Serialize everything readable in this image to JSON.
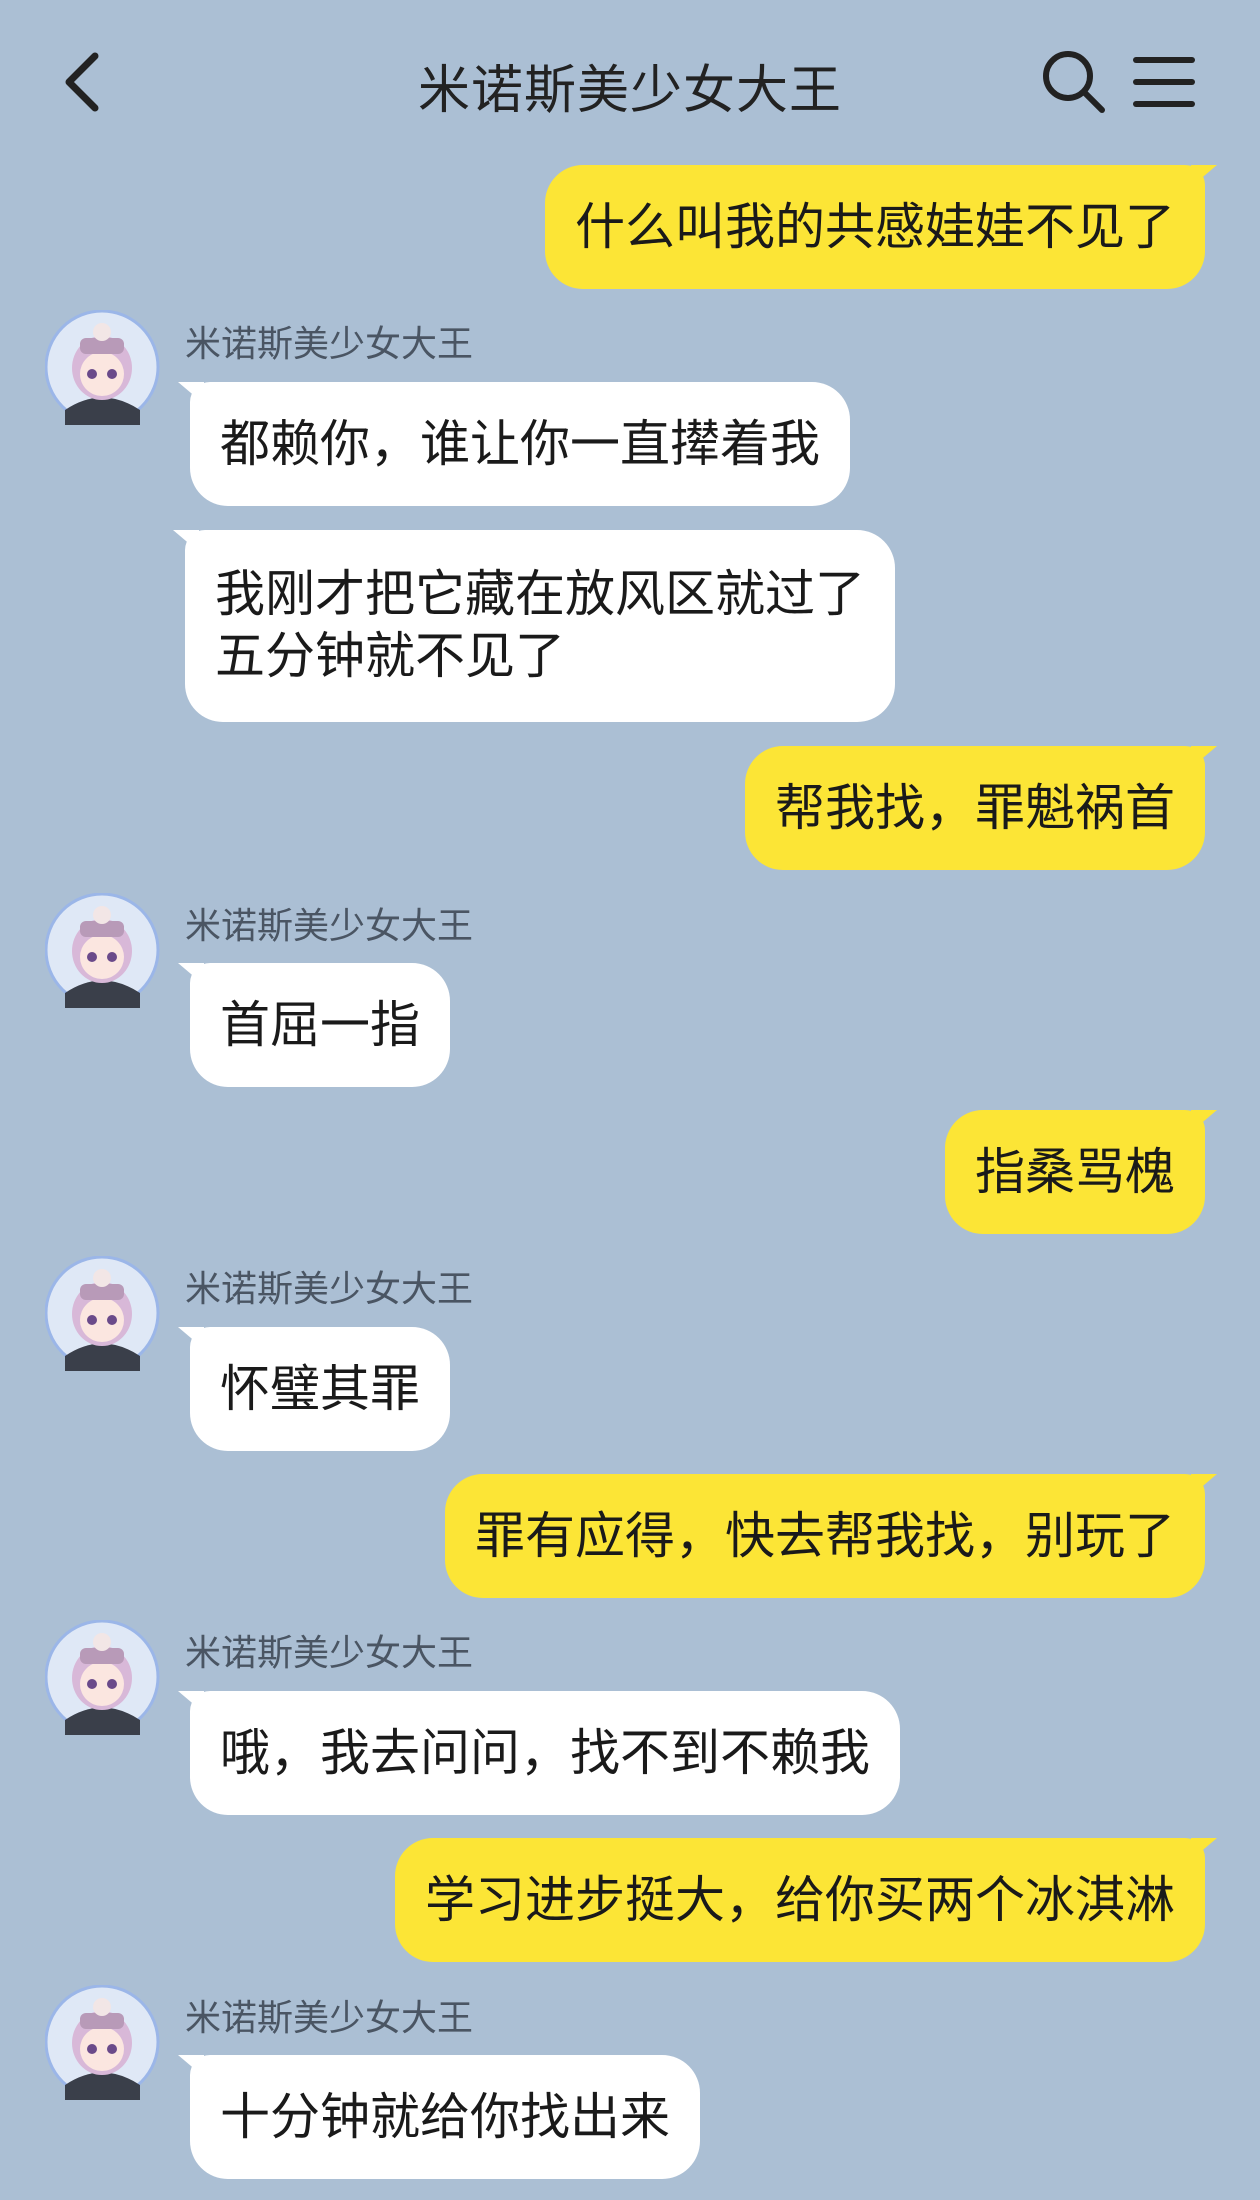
{
  "header": {
    "title": "米诺斯美少女大王"
  },
  "contact": {
    "name": "米诺斯美少女大王"
  },
  "messages": [
    {
      "side": "me",
      "lines": [
        "什么叫我的共感娃娃不见了"
      ]
    },
    {
      "side": "them",
      "lines": [
        "都赖你，谁让你一直撵着我"
      ]
    },
    {
      "side": "them",
      "lines": [
        "我刚才把它藏在放风区就过了",
        "五分钟就不见了"
      ]
    },
    {
      "side": "me",
      "lines": [
        "帮我找，罪魁祸首"
      ]
    },
    {
      "side": "them",
      "lines": [
        "首屈一指"
      ]
    },
    {
      "side": "me",
      "lines": [
        "指桑骂槐"
      ]
    },
    {
      "side": "them",
      "lines": [
        "怀璧其罪"
      ]
    },
    {
      "side": "me",
      "lines": [
        "罪有应得，快去帮我找，别玩了"
      ]
    },
    {
      "side": "them",
      "lines": [
        "哦，我去问问，找不到不赖我"
      ]
    },
    {
      "side": "me",
      "lines": [
        "学习进步挺大，给你买两个冰淇淋"
      ]
    },
    {
      "side": "them",
      "lines": [
        "十分钟就给你找出来"
      ]
    }
  ],
  "colors": {
    "background": "#abbfd4",
    "my_bubble": "#fce536",
    "their_bubble": "#ffffff"
  },
  "icons": [
    "back-arrow-icon",
    "search-icon",
    "menu-icon",
    "avatar"
  ]
}
